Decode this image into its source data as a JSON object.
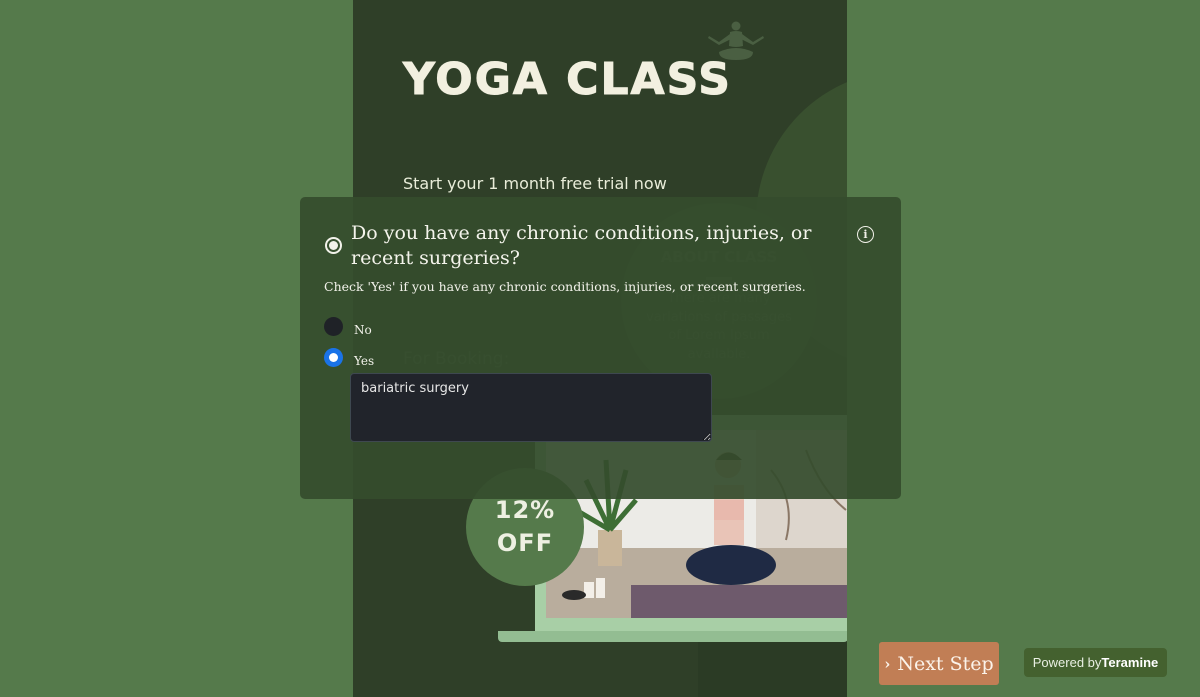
{
  "flyer": {
    "title": "YOGA CLASS",
    "subtitle": "Start your 1 month free trial now",
    "about_title": "ABOUT CLASS",
    "about_text": "There are many variations of passages of Lorem Ipsum available.",
    "booking_label": "For Booking:",
    "discount_line1": "12%",
    "discount_line2": "OFF",
    "icon": "meditating-person-icon"
  },
  "question": {
    "title": "Do you have any chronic conditions, injuries, or recent surgeries?",
    "hint": "Check 'Yes' if you have any chronic conditions, injuries, or recent surgeries.",
    "info_icon": "info-icon",
    "info_glyph": "i",
    "options": [
      {
        "label": "No",
        "selected": false
      },
      {
        "label": "Yes",
        "selected": true
      }
    ],
    "details_value": "bariatric surgery"
  },
  "footer": {
    "next_chevron": "›",
    "next_label": "Next Step",
    "powered_prefix": "Powered by",
    "powered_brand": "Teramine"
  },
  "colors": {
    "page_bg": "#557a4b",
    "flyer_bg": "#2f3f28",
    "modal_bg": "#354c2d",
    "accent_radio": "#1a73e8",
    "next_button": "#c17e55",
    "powered_badge": "#44612f"
  }
}
